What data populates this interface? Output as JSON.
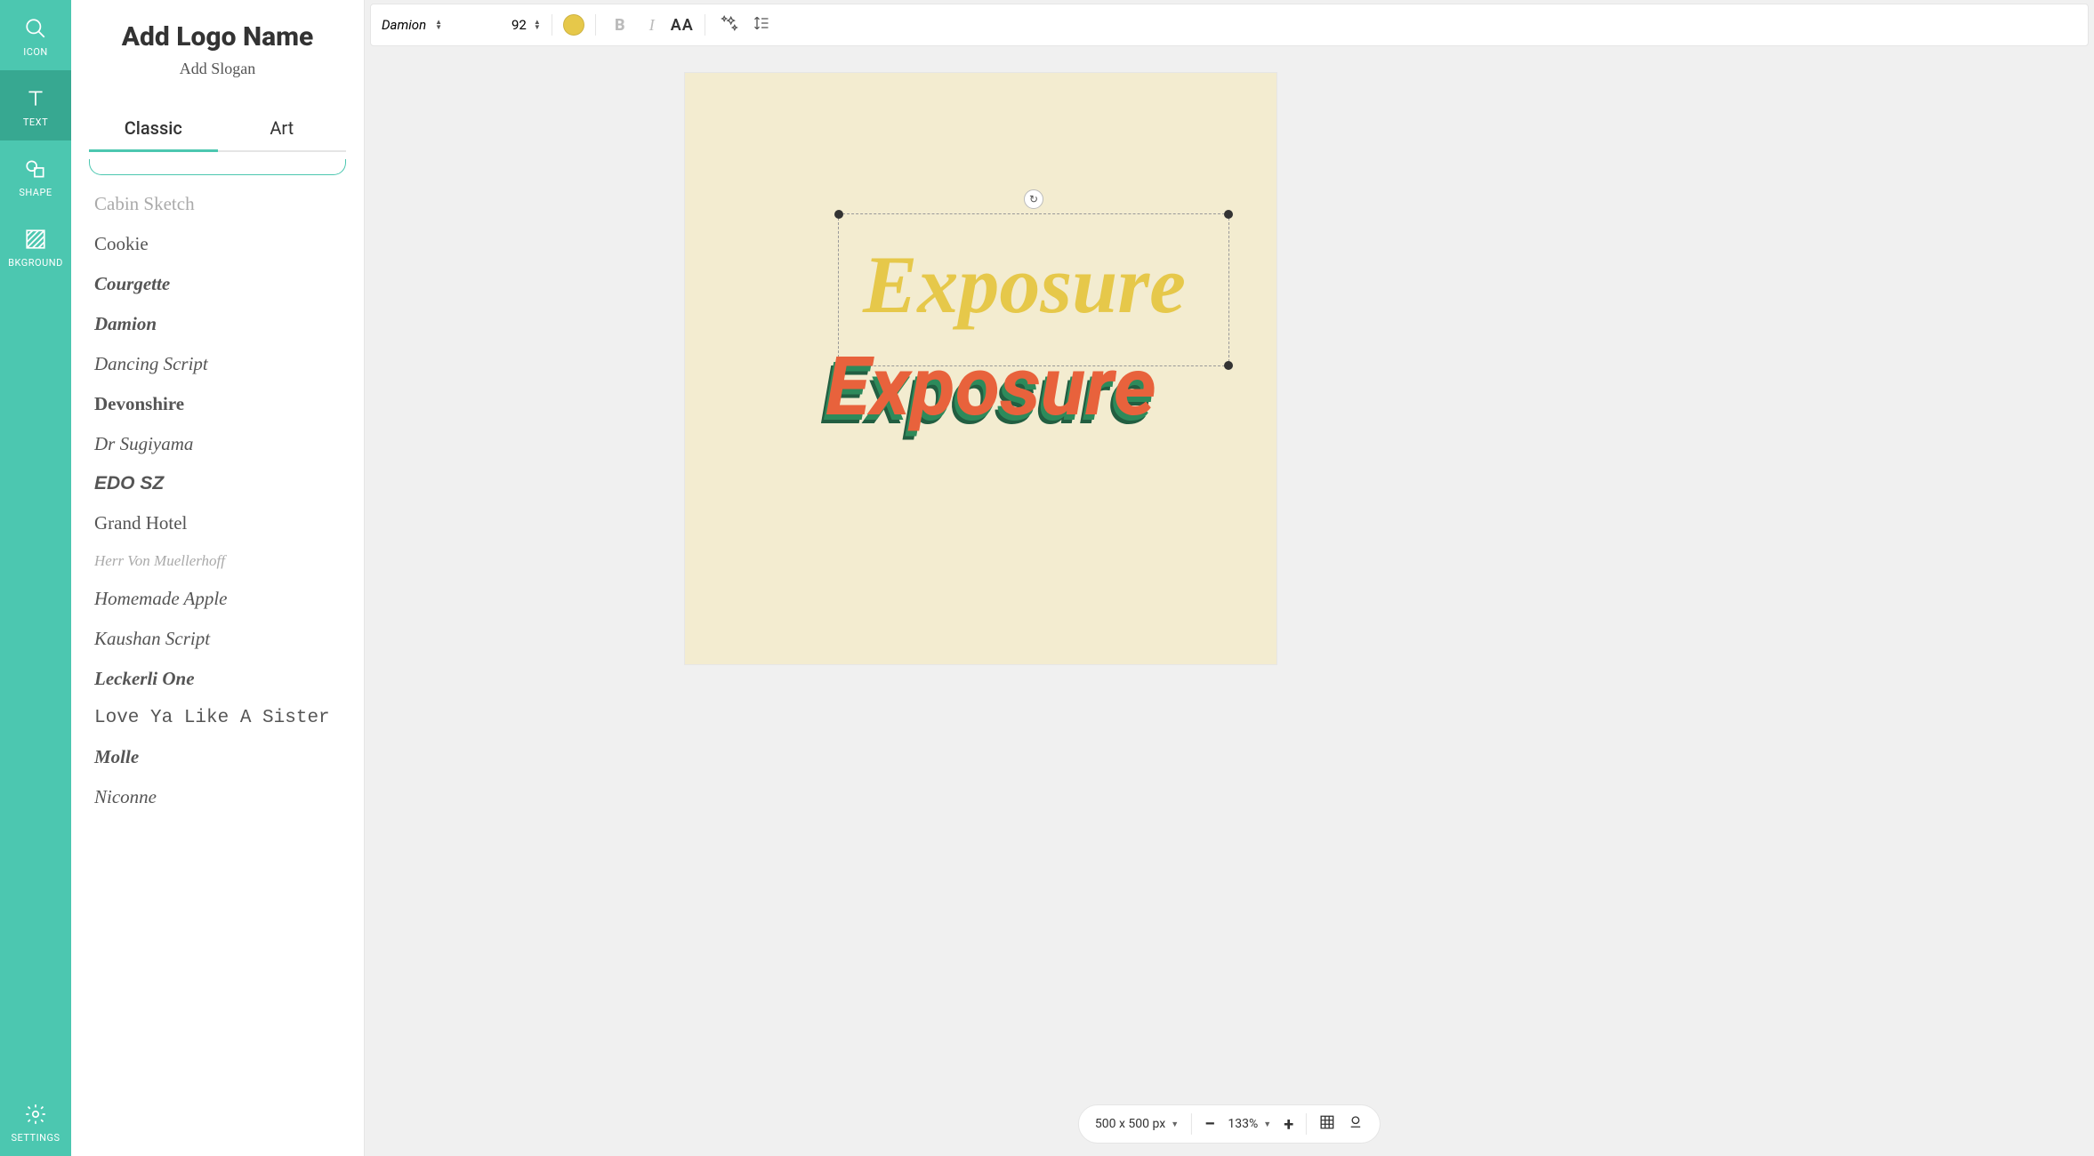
{
  "sidebar": {
    "items": [
      {
        "label": "ICON"
      },
      {
        "label": "TEXT"
      },
      {
        "label": "SHAPE"
      },
      {
        "label": "BKGROUND"
      },
      {
        "label": "SETTINGS"
      }
    ]
  },
  "panel": {
    "title": "Add Logo Name",
    "slogan": "Add Slogan",
    "tabs": [
      {
        "label": "Classic",
        "active": true
      },
      {
        "label": "Art",
        "active": false
      }
    ],
    "fonts": [
      "Cabin Sketch",
      "Cookie",
      "Courgette",
      "Damion",
      "Dancing Script",
      "Devonshire",
      "Dr Sugiyama",
      "EDO SZ",
      "Grand Hotel",
      "Herr Von Muellerhoff",
      "Homemade Apple",
      "Kaushan Script",
      "Leckerli One",
      "Love Ya Like A Sister",
      "Molle",
      "Niconne"
    ]
  },
  "toolbar": {
    "font_name": "Damion",
    "font_size": "92",
    "color": "#e6c84a",
    "bold_label": "B",
    "italic_label": "I",
    "case_label": "AA"
  },
  "canvas": {
    "background": "#f3ecd0",
    "text_top": "Exposure",
    "text_bottom": "Exposure",
    "colors": {
      "top": "#e6c84a",
      "bottom_front": "#e8623c",
      "bottom_shadow1": "#2d8a5b",
      "bottom_shadow2": "#225e41"
    }
  },
  "bottom": {
    "dimensions": "500 x 500 px",
    "zoom": "133%",
    "minus": "−",
    "plus": "+"
  }
}
